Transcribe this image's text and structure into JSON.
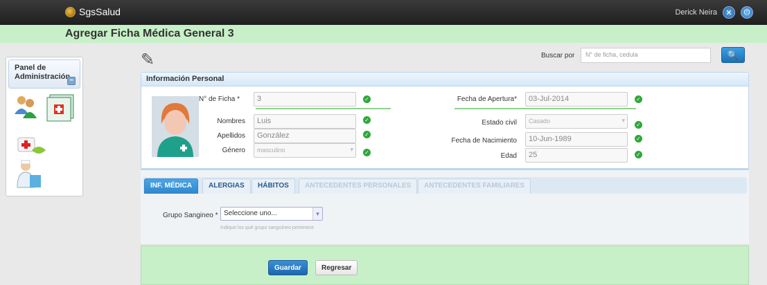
{
  "app": {
    "name": "SgsSalud",
    "user": "Derick Neira"
  },
  "page": {
    "title": "Agregar Ficha Médica General 3"
  },
  "sidebar": {
    "title": "Panel de Administración",
    "collapse": "−"
  },
  "search": {
    "label": "Buscar por",
    "placeholder": "N° de ficha, cedula"
  },
  "personal": {
    "header": "Información Personal",
    "ficha_label": "N° de Ficha *",
    "ficha_value": "3",
    "nombres_label": "Nombres",
    "nombres_value": "Luis",
    "apellidos_label": "Apellidos",
    "apellidos_value": "González",
    "genero_label": "Género",
    "genero_value": "masculino",
    "apertura_label": "Fecha de Apertura*",
    "apertura_value": "03-Jul-2014",
    "civil_label": "Estado civil",
    "civil_value": "Casado",
    "nacimiento_label": "Fecha de Nacimiento",
    "nacimiento_value": "10-Jun-1989",
    "edad_label": "Edad",
    "edad_value": "25"
  },
  "tabs": [
    "INF. MÉDICA",
    "ALERGIAS",
    "HÁBITOS",
    "ANTECEDENTES PERSONALES",
    "ANTECEDENTES FAMILIARES"
  ],
  "medical": {
    "grupo_label": "Grupo Sangineo *",
    "grupo_value": "Seleccione uno...",
    "hint": "Indique los qué grupo sanguíneo pertenece"
  },
  "actions": {
    "save": "Guardar",
    "back": "Regresar"
  }
}
